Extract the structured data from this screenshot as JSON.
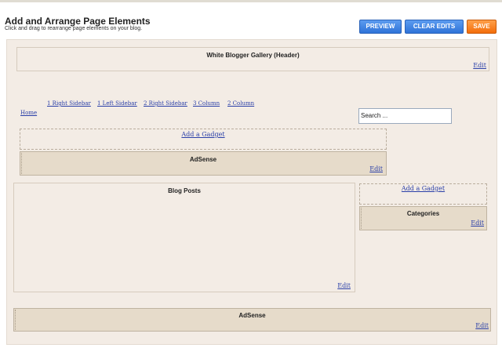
{
  "header": {
    "title": "Add and Arrange Page Elements",
    "subtitle": "Click and drag to rearrange page elements on your blog.",
    "preview_label": "PREVIEW",
    "clear_label": "CLEAR EDITS",
    "save_label": "SAVE"
  },
  "layout": {
    "header_widget": {
      "title": "White Blogger Gallery (Header)",
      "edit": "Edit"
    },
    "nav": {
      "links": [
        "1 Right Sidebar",
        "1 Left Sidebar",
        "2 Right Sidebar",
        "3 Column",
        "2 Column"
      ],
      "home": "Home"
    },
    "search": {
      "value": "Search ..."
    },
    "top_section": {
      "add_gadget": "Add a Gadget",
      "adsense": {
        "title": "AdSense",
        "edit": "Edit"
      }
    },
    "main": {
      "blog_posts": {
        "title": "Blog Posts",
        "edit": "Edit"
      }
    },
    "sidebar": {
      "add_gadget": "Add a Gadget",
      "categories": {
        "title": "Categories",
        "edit": "Edit"
      }
    },
    "footer": {
      "adsense": {
        "title": "AdSense",
        "edit": "Edit"
      }
    }
  },
  "colors": {
    "canvas_bg": "#f3ece5",
    "widget_bg": "#e6dbca",
    "link": "#2a3fa8",
    "preview_button": "#2f73d8",
    "save_button": "#f36d0a"
  }
}
